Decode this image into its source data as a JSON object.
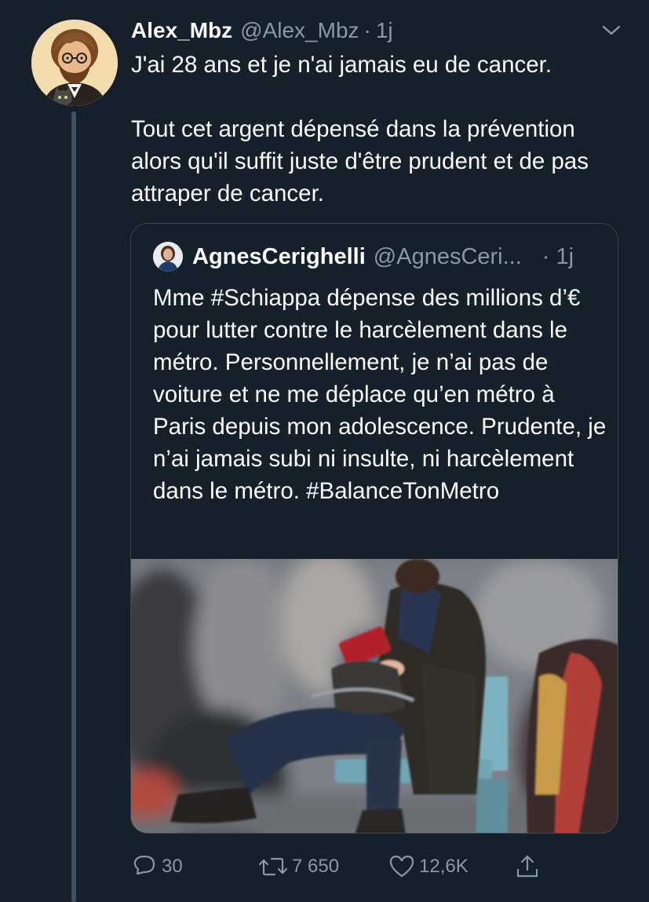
{
  "tweet": {
    "display_name": "Alex_Mbz",
    "handle": "@Alex_Mbz",
    "separator": "·",
    "time": "1j",
    "text_line1": "J'ai 28 ans et je n'ai jamais eu de cancer.",
    "text_para2": "Tout cet argent dépensé dans la prévention alors qu'il suffit juste d'être prudent et de pas attraper de cancer."
  },
  "quoted": {
    "display_name": "AgnesCerighelli",
    "handle": "@AgnesCeri...",
    "separator": "·",
    "time": "1j",
    "text": "Mme #Schiappa dépense des millions d’€ pour lutter contre le harcèlement dans le métro. Personnellement, je n’ai pas de voiture et ne me déplace qu’en métro à Paris depuis mon adolescence. Prudente, je n’ai jamais subi ni insulte, ni harcèlement dans le métro. #BalanceTonMetro"
  },
  "actions": {
    "reply_count": "30",
    "retweet_count": "7 650",
    "like_count": "12,6K"
  },
  "icons": {
    "reply": "reply-icon",
    "retweet": "retweet-icon",
    "like": "heart-icon",
    "share": "share-icon",
    "more": "chevron-down-icon"
  },
  "colors": {
    "background": "#15202b",
    "text_primary": "#ffffff",
    "text_secondary": "#8899a6",
    "border": "#38444d"
  }
}
